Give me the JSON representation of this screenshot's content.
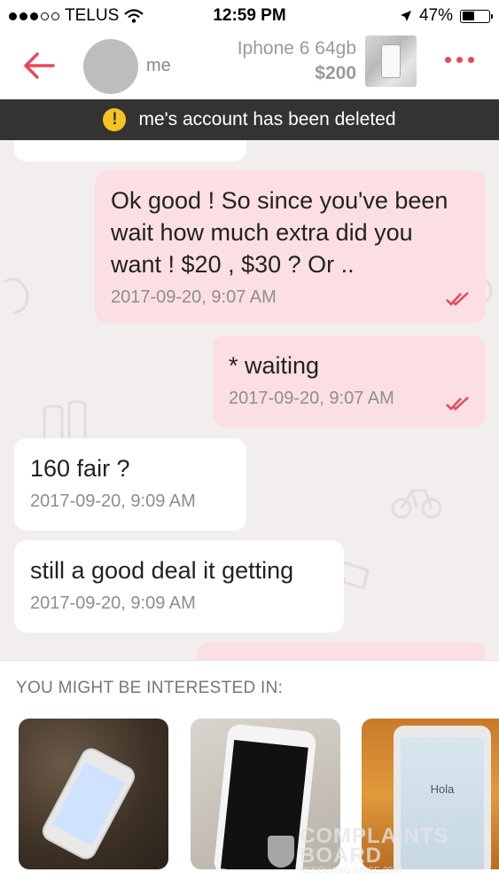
{
  "status_bar": {
    "carrier": "TELUS",
    "time": "12:59 PM",
    "battery": "47%",
    "battery_level": 0.47
  },
  "header": {
    "username": "me",
    "listing_title": "Iphone 6 64gb",
    "listing_price": "$200"
  },
  "banner": {
    "icon_text": "!",
    "text": "me's account has been deleted"
  },
  "messages": [
    {
      "direction": "out",
      "text": "Ok good ! So since you've been wait how much extra did you want ! $20 , $30 ? Or ..",
      "time": "2017-09-20, 9:07 AM"
    },
    {
      "direction": "out",
      "text": "* waiting",
      "time": "2017-09-20, 9:07 AM"
    },
    {
      "direction": "in",
      "text": "160 fair ?",
      "time": "2017-09-20, 9:09 AM"
    },
    {
      "direction": "in",
      "text": "still a good deal it getting",
      "time": "2017-09-20, 9:09 AM"
    }
  ],
  "suggestions": {
    "title": "YOU MIGHT BE INTERESTED IN:",
    "items": [
      {
        "image": "iphone-on-granite"
      },
      {
        "image": "iphone-front-white"
      },
      {
        "image": "iphone-hola-screen",
        "screen_text": "Hola"
      }
    ]
  },
  "watermark": {
    "line1": "COMPLAINTS",
    "line2": "BOARD",
    "tag": "RESOLVING SINCE 2004"
  },
  "colors": {
    "accent": "#e8485a",
    "outgoing": "#fbdfe2",
    "banner": "#333333",
    "warning": "#f5c322"
  }
}
